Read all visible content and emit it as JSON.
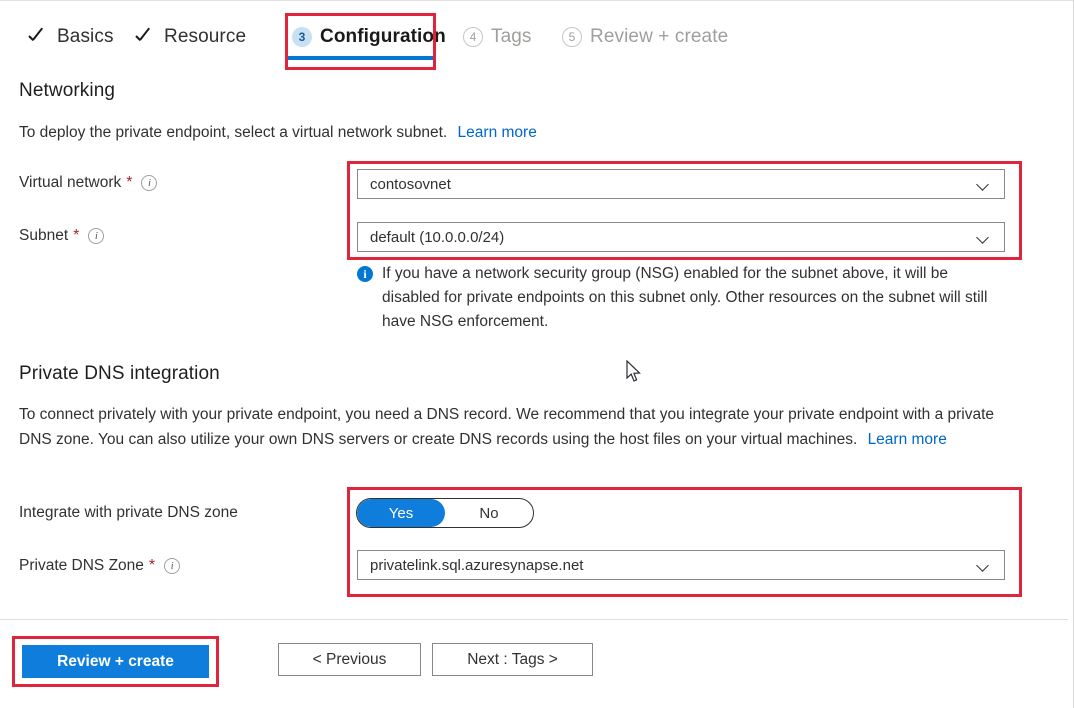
{
  "wizard": {
    "tabs": [
      {
        "label": "Basics",
        "state": "done",
        "icon": "check-icon"
      },
      {
        "label": "Resource",
        "state": "done",
        "icon": "check-icon"
      },
      {
        "label": "Configuration",
        "state": "active",
        "step": "3"
      },
      {
        "label": "Tags",
        "state": "disabled",
        "step": "4"
      },
      {
        "label": "Review + create",
        "state": "disabled",
        "step": "5"
      }
    ]
  },
  "networking": {
    "title": "Networking",
    "description": "To deploy the private endpoint, select a virtual network subnet.",
    "learn_more": "Learn more",
    "virtual_network": {
      "label": "Virtual network",
      "required_marker": "*",
      "value": "contosovnet"
    },
    "subnet": {
      "label": "Subnet",
      "required_marker": "*",
      "value": "default (10.0.0.0/24)"
    },
    "info_message": "If you have a network security group (NSG) enabled for the subnet above, it will be disabled for private endpoints on this subnet only. Other resources on the subnet will still have NSG enforcement.",
    "info_icon_glyph": "i"
  },
  "private_dns": {
    "title": "Private DNS integration",
    "description": "To connect privately with your private endpoint, you need a DNS record. We recommend that you integrate your private endpoint with a private DNS zone. You can also utilize your own DNS servers or create DNS records using the host files on your virtual machines.",
    "learn_more": "Learn more",
    "integrate_toggle": {
      "label": "Integrate with private DNS zone",
      "yes_label": "Yes",
      "no_label": "No",
      "selected": "Yes"
    },
    "dns_zone": {
      "label": "Private DNS Zone",
      "required_marker": "*",
      "value": "privatelink.sql.azuresynapse.net"
    }
  },
  "footer": {
    "review_create_label": "Review + create",
    "previous_label": "< Previous",
    "next_label": "Next : Tags >"
  },
  "colors": {
    "accent_blue": "#0078d4",
    "toggle_blue": "#0f7ddb",
    "annotation_red": "#e0243c",
    "required_red": "#a4262c",
    "link_blue": "#0066cc",
    "step_badge_bg": "#c7e0f4"
  }
}
